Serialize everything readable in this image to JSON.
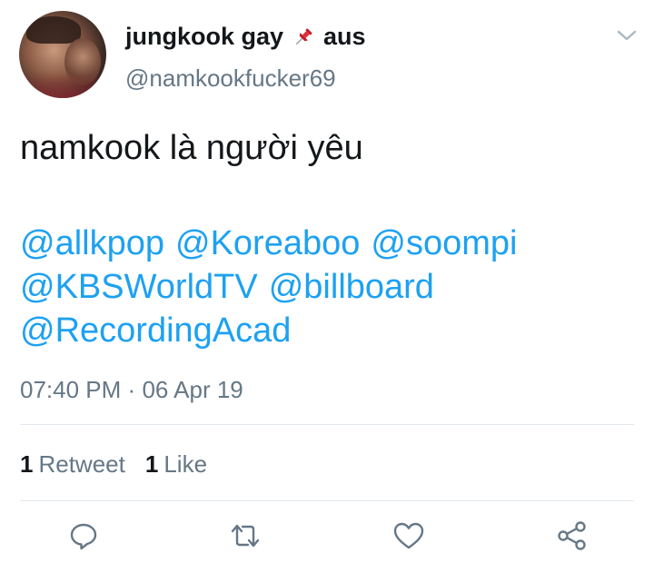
{
  "tweet": {
    "display_name": "jungkook gay",
    "pin_emoji": "📌",
    "location_suffix": "aus",
    "handle": "@namkookfucker69",
    "text": "namkook là người yêu",
    "mentions": [
      "@allkpop",
      "@Koreaboo",
      "@soompi",
      "@KBSWorldTV",
      "@billboard",
      "@RecordingAcad"
    ],
    "time": "07:40 PM",
    "separator": "·",
    "date": "06 Apr 19"
  },
  "stats": {
    "retweet_count": "1",
    "retweet_label": "Retweet",
    "like_count": "1",
    "like_label": "Like"
  },
  "actions": {
    "reply_icon": "reply-icon",
    "retweet_icon": "retweet-icon",
    "like_icon": "heart-icon",
    "share_icon": "share-icon"
  },
  "colors": {
    "link": "#1da1f2",
    "secondary": "#657786",
    "icon": "#657786",
    "text": "#14171a",
    "divider": "#e1e8ed"
  }
}
